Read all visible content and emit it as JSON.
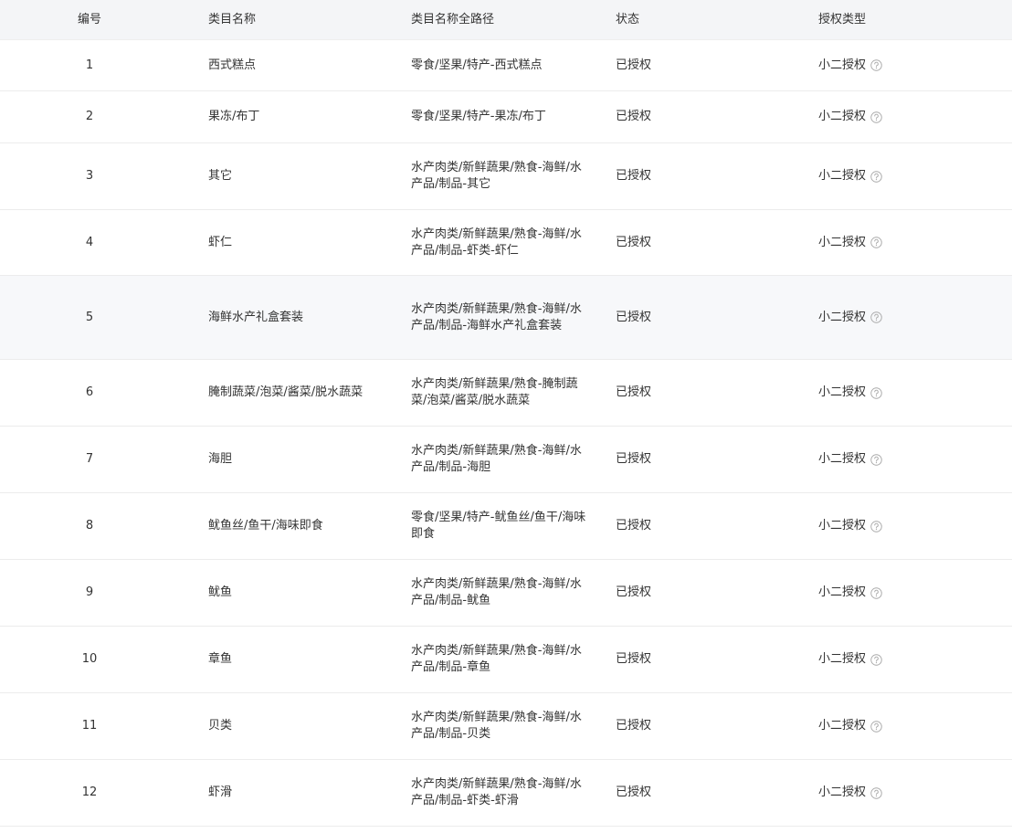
{
  "table": {
    "columns": {
      "num": "编号",
      "name": "类目名称",
      "path": "类目名称全路径",
      "status": "状态",
      "auth_type": "授权类型"
    },
    "rows": [
      {
        "num": "1",
        "name": "西式糕点",
        "path": "零食/坚果/特产-西式糕点",
        "status": "已授权",
        "auth_type": "小二授权"
      },
      {
        "num": "2",
        "name": "果冻/布丁",
        "path": "零食/坚果/特产-果冻/布丁",
        "status": "已授权",
        "auth_type": "小二授权"
      },
      {
        "num": "3",
        "name": "其它",
        "path": "水产肉类/新鲜蔬果/熟食-海鲜/水产品/制品-其它",
        "status": "已授权",
        "auth_type": "小二授权"
      },
      {
        "num": "4",
        "name": "虾仁",
        "path": "水产肉类/新鲜蔬果/熟食-海鲜/水产品/制品-虾类-虾仁",
        "status": "已授权",
        "auth_type": "小二授权"
      },
      {
        "num": "5",
        "name": "海鲜水产礼盒套装",
        "path": "水产肉类/新鲜蔬果/熟食-海鲜/水产品/制品-海鲜水产礼盒套装",
        "status": "已授权",
        "auth_type": "小二授权"
      },
      {
        "num": "6",
        "name": "腌制蔬菜/泡菜/酱菜/脱水蔬菜",
        "path": "水产肉类/新鲜蔬果/熟食-腌制蔬菜/泡菜/酱菜/脱水蔬菜",
        "status": "已授权",
        "auth_type": "小二授权"
      },
      {
        "num": "7",
        "name": "海胆",
        "path": "水产肉类/新鲜蔬果/熟食-海鲜/水产品/制品-海胆",
        "status": "已授权",
        "auth_type": "小二授权"
      },
      {
        "num": "8",
        "name": "鱿鱼丝/鱼干/海味即食",
        "path": "零食/坚果/特产-鱿鱼丝/鱼干/海味即食",
        "status": "已授权",
        "auth_type": "小二授权"
      },
      {
        "num": "9",
        "name": "鱿鱼",
        "path": "水产肉类/新鲜蔬果/熟食-海鲜/水产品/制品-鱿鱼",
        "status": "已授权",
        "auth_type": "小二授权"
      },
      {
        "num": "10",
        "name": "章鱼",
        "path": "水产肉类/新鲜蔬果/熟食-海鲜/水产品/制品-章鱼",
        "status": "已授权",
        "auth_type": "小二授权"
      },
      {
        "num": "11",
        "name": "贝类",
        "path": "水产肉类/新鲜蔬果/熟食-海鲜/水产品/制品-贝类",
        "status": "已授权",
        "auth_type": "小二授权"
      },
      {
        "num": "12",
        "name": "虾滑",
        "path": "水产肉类/新鲜蔬果/熟食-海鲜/水产品/制品-虾类-虾滑",
        "status": "已授权",
        "auth_type": "小二授权"
      }
    ],
    "help_icon": "question-circle-icon",
    "colors": {
      "header_bg": "#f4f5f7",
      "hover_row_bg": "#f7f8fa",
      "border": "#ececec",
      "text": "#333333",
      "icon": "#aaaaaa"
    }
  }
}
